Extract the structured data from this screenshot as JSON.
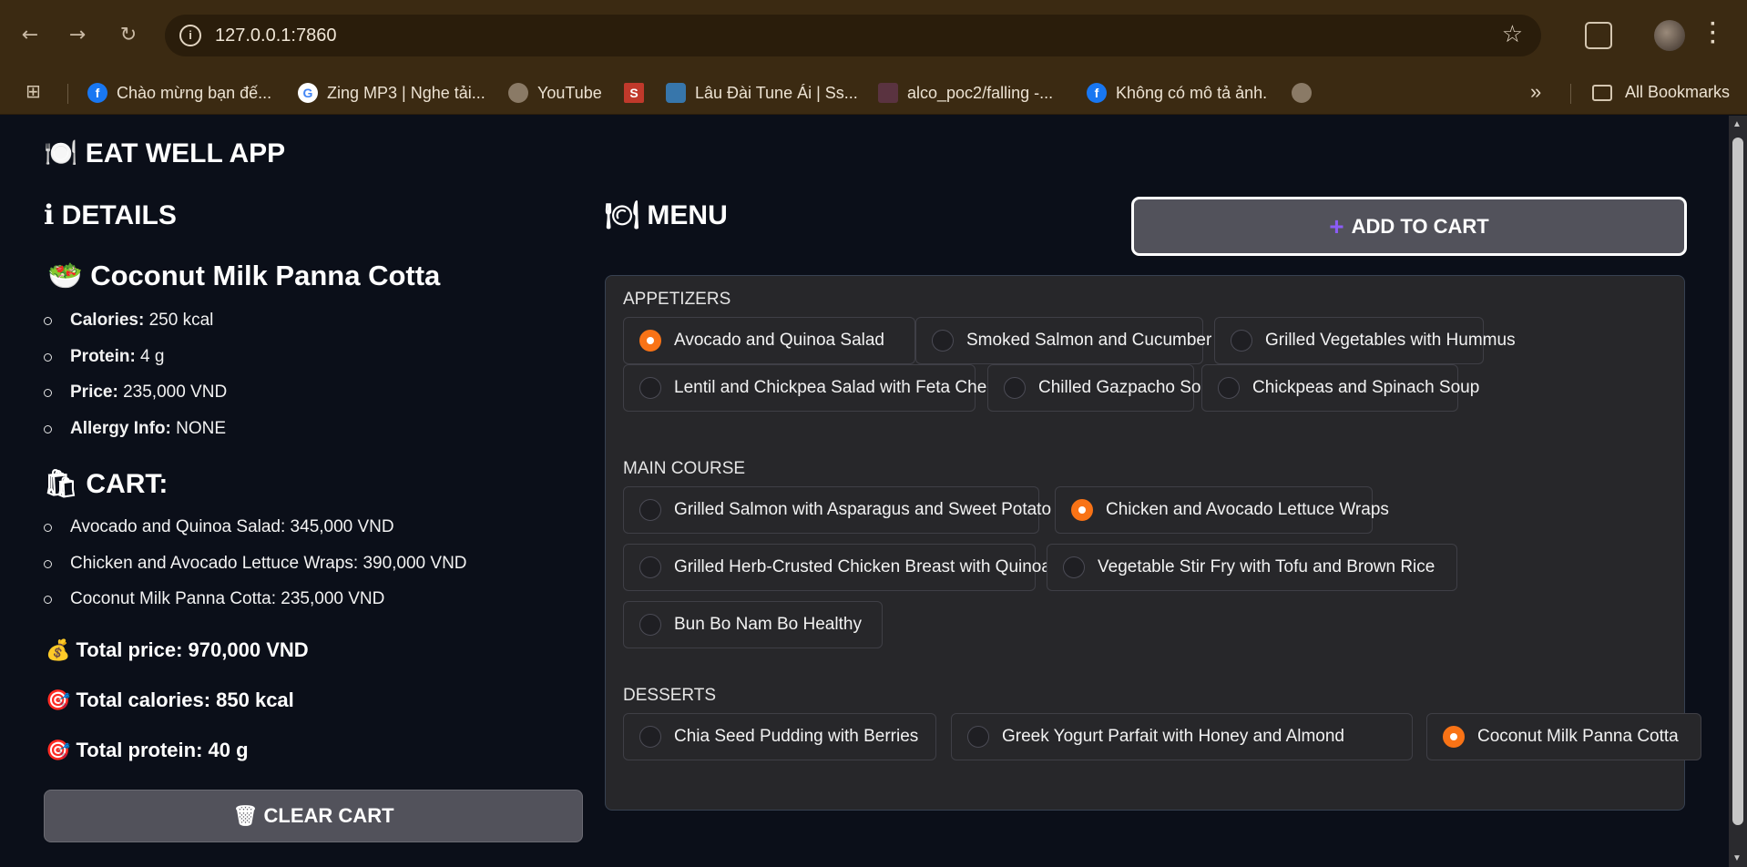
{
  "browser": {
    "url": "127.0.0.1:7860",
    "icons": {
      "back": "arrow-left-icon",
      "forward": "arrow-right-icon",
      "reload": "reload-icon",
      "star": "star-icon",
      "extensions": "puzzle-icon",
      "menu": "kebab-icon"
    },
    "bookmarks": [
      {
        "label": "Chào mừng bạn đế...",
        "icon": "facebook-icon"
      },
      {
        "label": "Zing MP3 | Nghe tải...",
        "icon": "google-icon"
      },
      {
        "label": "YouTube",
        "icon": "globe-icon"
      },
      {
        "label": "",
        "icon": "s-logo-icon"
      },
      {
        "label": "Lâu Đài Tune Ái | Ss...",
        "icon": "python-icon"
      },
      {
        "label": "alco_poc2/falling -...",
        "icon": "bot-icon"
      },
      {
        "label": "Không có mô tả ảnh.",
        "icon": "facebook-icon"
      },
      {
        "label": "",
        "icon": "globe-icon"
      }
    ],
    "more": "»",
    "all_bookmarks": "All Bookmarks"
  },
  "app": {
    "title": "🍽️ EAT WELL APP",
    "details_heading": "ℹ DETAILS",
    "dish_name": "🥗 Coconut Milk Panna Cotta",
    "details": [
      {
        "key": "Calories:",
        "value": " 250 kcal"
      },
      {
        "key": "Protein:",
        "value": " 4 g"
      },
      {
        "key": "Price:",
        "value": " 235,000 VND"
      },
      {
        "key": "Allergy Info:",
        "value": " NONE"
      }
    ],
    "cart_heading": "🛍 CART:",
    "cart_items": [
      "Avocado and Quinoa Salad: 345,000 VND",
      "Chicken and Avocado Lettuce Wraps: 390,000 VND",
      "Coconut Milk Panna Cotta: 235,000 VND"
    ],
    "total_price": "💰 Total price: 970,000 VND",
    "total_calories": "🎯 Total calories: 850 kcal",
    "total_protein": "🎯 Total protein: 40 g",
    "clear_cart": "🗑 CLEAR CART",
    "menu_heading": "🍽 MENU",
    "add_to_cart": "ADD TO CART",
    "accent_color": "#f97316",
    "categories": {
      "appetizers": {
        "label": "APPETIZERS",
        "options": [
          "Avocado and Quinoa Salad",
          "Smoked Salmon and Cucumber Roll",
          "Grilled Vegetables with Hummus",
          "Lentil and Chickpea Salad with Feta Cheese",
          "Chilled Gazpacho Soup",
          "Chickpeas and Spinach Soup"
        ],
        "selected": "Avocado and Quinoa Salad"
      },
      "main": {
        "label": "MAIN COURSE",
        "options": [
          "Grilled Salmon with Asparagus and Sweet Potato Mash",
          "Chicken and Avocado Lettuce Wraps",
          "Grilled Herb-Crusted Chicken Breast with Quinoa Pilaf",
          "Vegetable Stir Fry with Tofu and Brown Rice",
          "Bun Bo Nam Bo Healthy"
        ],
        "selected": "Chicken and Avocado Lettuce Wraps"
      },
      "desserts": {
        "label": "DESSERTS",
        "options": [
          "Chia Seed Pudding with Berries",
          "Greek Yogurt Parfait with Honey and Almond",
          "Coconut Milk Panna Cotta"
        ],
        "selected": "Coconut Milk Panna Cotta"
      }
    }
  }
}
